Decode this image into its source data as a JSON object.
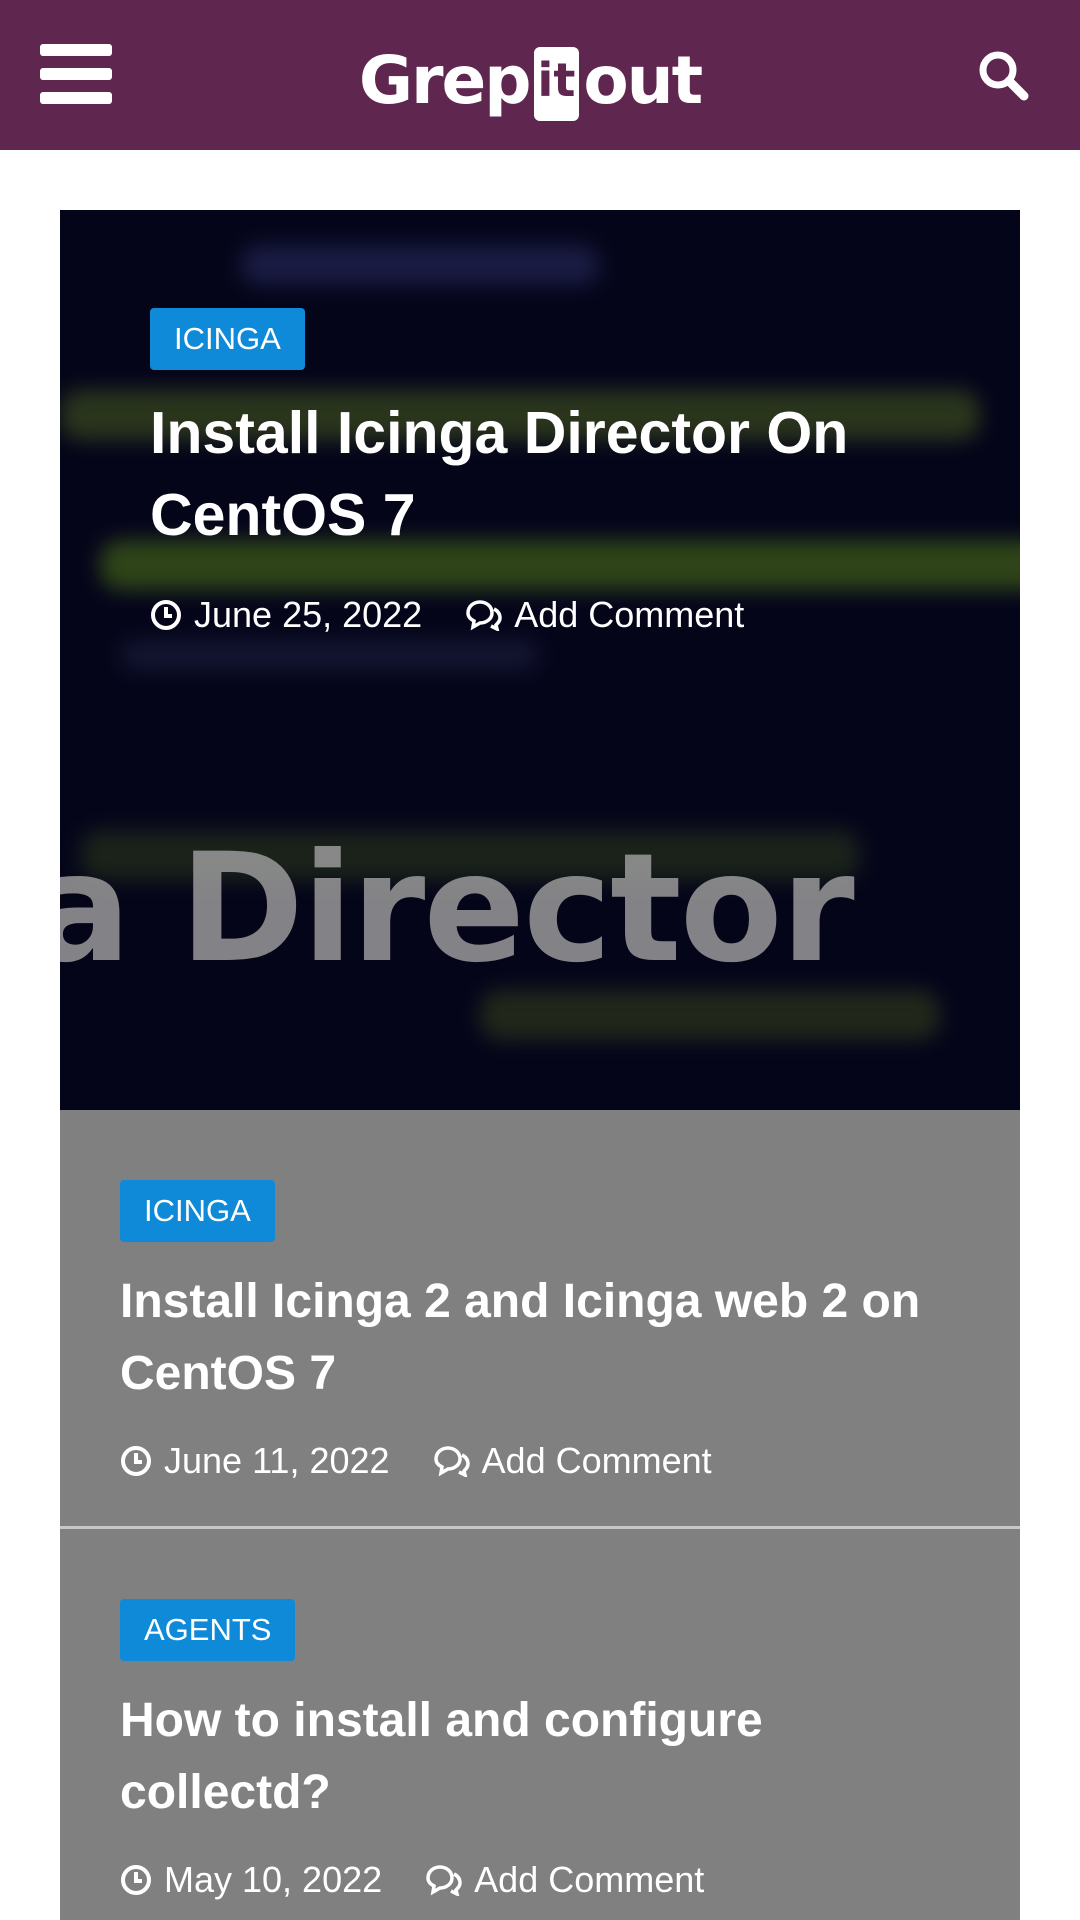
{
  "header": {
    "logo_part1": "Grep",
    "logo_badge": "it",
    "logo_part2": "out",
    "menu_icon": "hamburger-menu-icon",
    "search_icon": "search-icon",
    "background": "#5f264f"
  },
  "hero": {
    "category": "ICINGA",
    "title": "Install Icinga Director On CentOS 7",
    "date": "June 25, 2022",
    "comment_label": "Add Comment",
    "image_text": "a Director"
  },
  "posts": [
    {
      "category": "ICINGA",
      "title": "Install Icinga 2 and Icinga web 2 on CentOS 7",
      "date": "June 11, 2022",
      "comment_label": "Add Comment"
    },
    {
      "category": "AGENTS",
      "title": "How to install and configure collectd?",
      "date": "May 10, 2022",
      "comment_label": "Add Comment"
    }
  ],
  "colors": {
    "category_badge": "#0e8ad8",
    "card_background": "#808080",
    "hero_background": "#05051a"
  }
}
